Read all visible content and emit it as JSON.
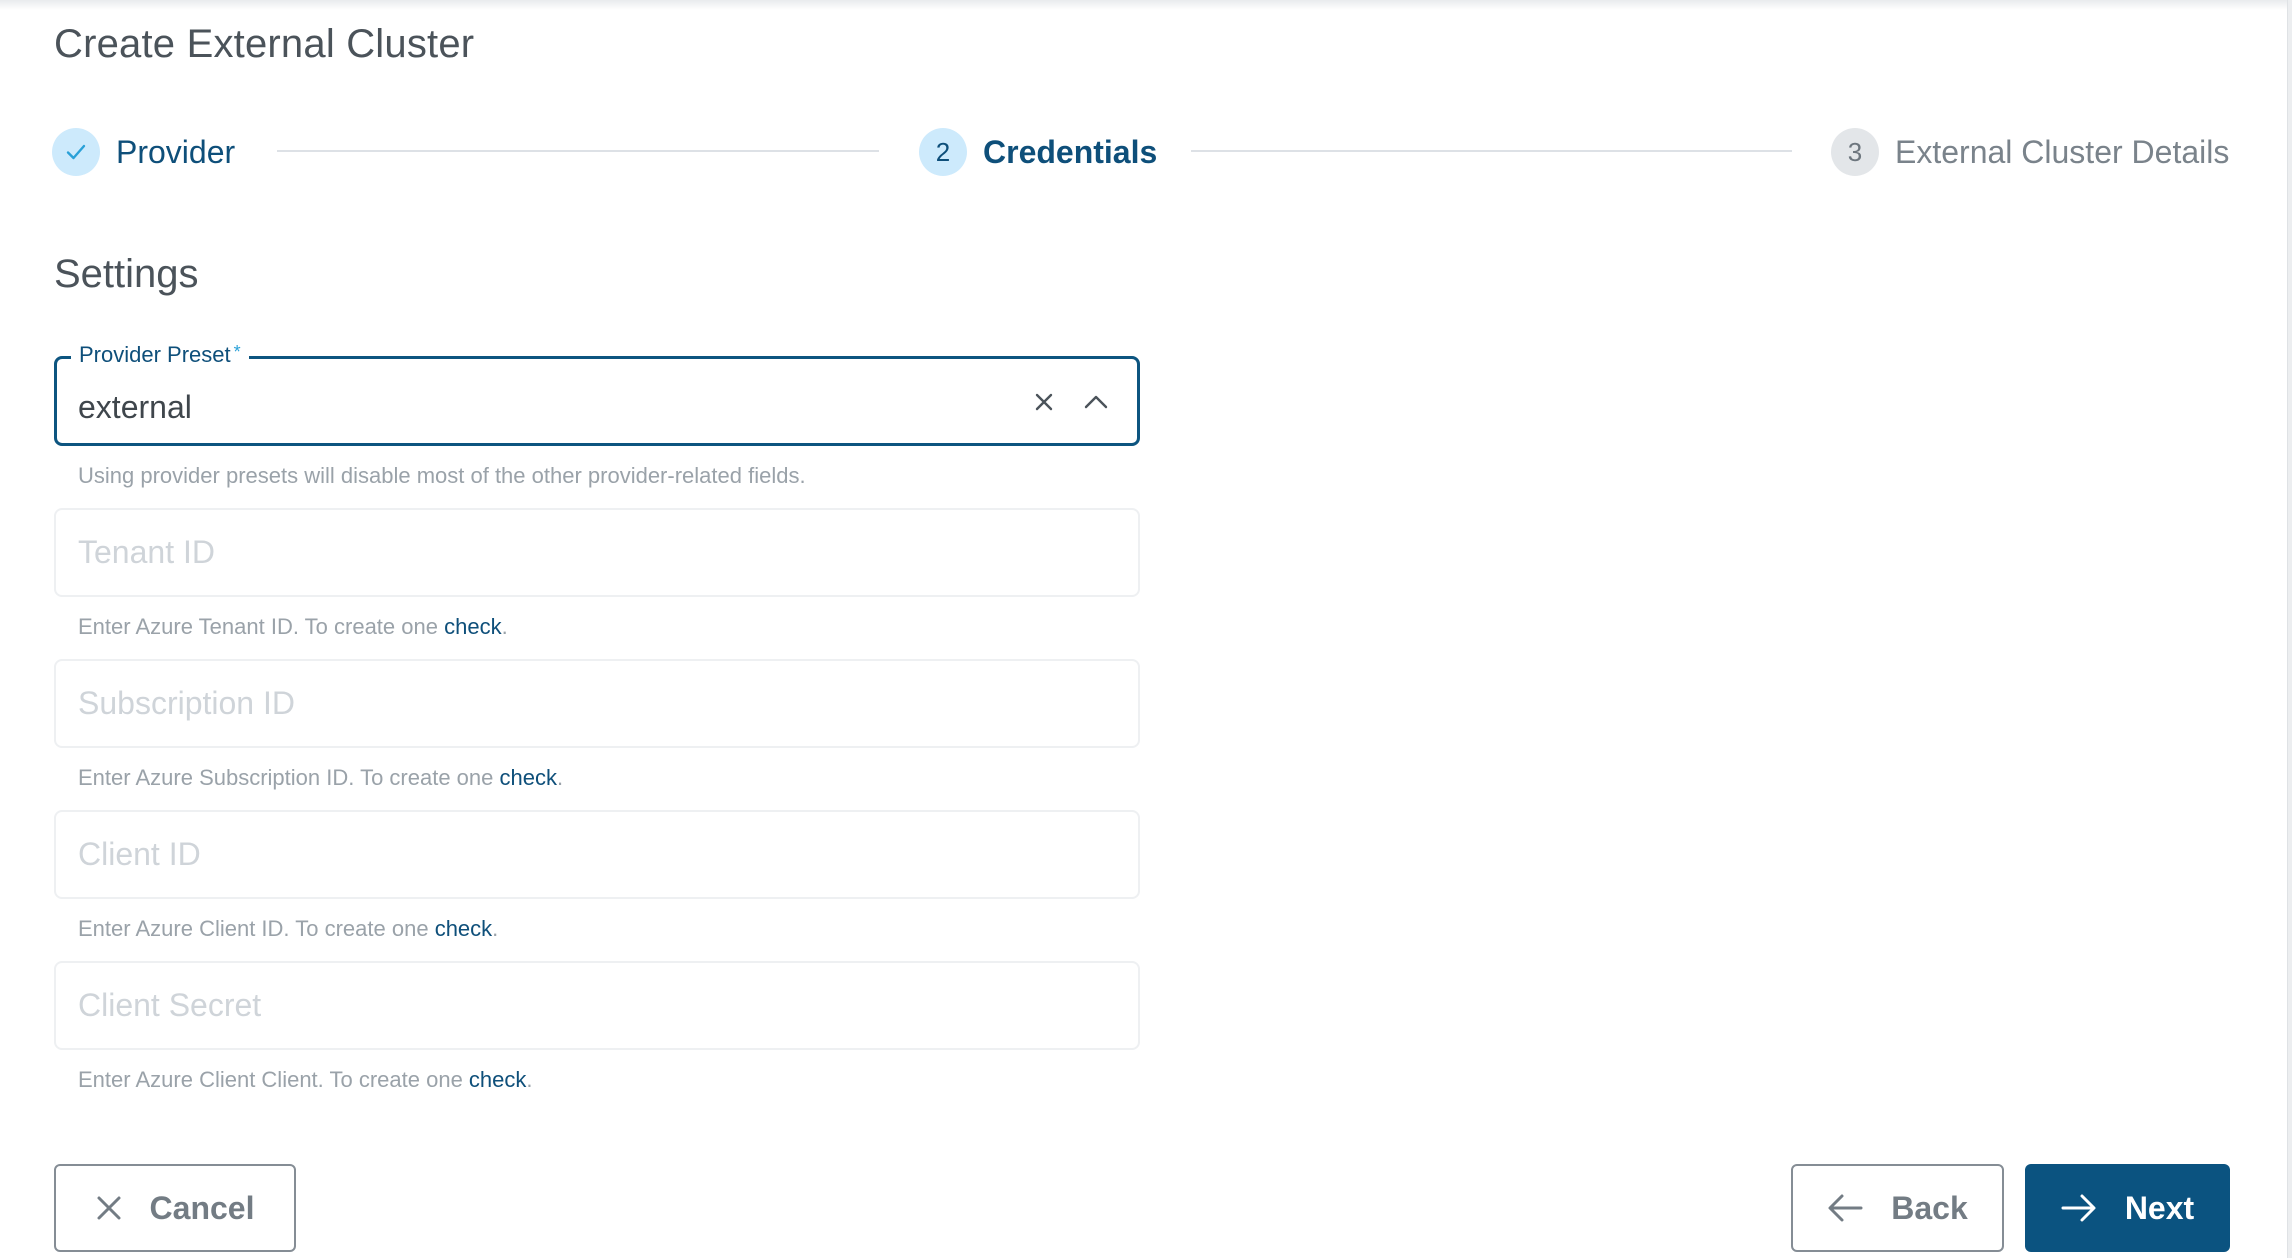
{
  "page": {
    "title": "Create External Cluster"
  },
  "stepper": {
    "steps": [
      {
        "index": "1",
        "label": "Provider",
        "status": "completed",
        "icon": "check-icon"
      },
      {
        "index": "2",
        "label": "Credentials",
        "status": "active"
      },
      {
        "index": "3",
        "label": "External Cluster Details",
        "status": "pending"
      }
    ]
  },
  "settings": {
    "title": "Settings",
    "provider_preset": {
      "label": "Provider Preset",
      "required_mark": "*",
      "value": "external",
      "hint": "Using provider presets will disable most of the other provider-related fields.",
      "clear_icon": "close-icon",
      "toggle_icon": "chevron-up-icon"
    },
    "fields": [
      {
        "placeholder": "Tenant ID",
        "value": "",
        "hint_prefix": "Enter Azure Tenant ID. To create one ",
        "link": "check",
        "hint_suffix": "."
      },
      {
        "placeholder": "Subscription ID",
        "value": "",
        "hint_prefix": "Enter Azure Subscription ID. To create one ",
        "link": "check",
        "hint_suffix": "."
      },
      {
        "placeholder": "Client ID",
        "value": "",
        "hint_prefix": "Enter Azure Client ID. To create one ",
        "link": "check",
        "hint_suffix": "."
      },
      {
        "placeholder": "Client Secret",
        "value": "",
        "hint_prefix": "Enter Azure Client Client. To create one ",
        "link": "check",
        "hint_suffix": "."
      }
    ]
  },
  "actions": {
    "cancel_label": "Cancel",
    "back_label": "Back",
    "next_label": "Next"
  },
  "colors": {
    "primary": "#0b5380",
    "accent": "#2aa1d8",
    "step_active_bg": "#cdeafc",
    "step_pending_bg": "#e3e6e9"
  }
}
